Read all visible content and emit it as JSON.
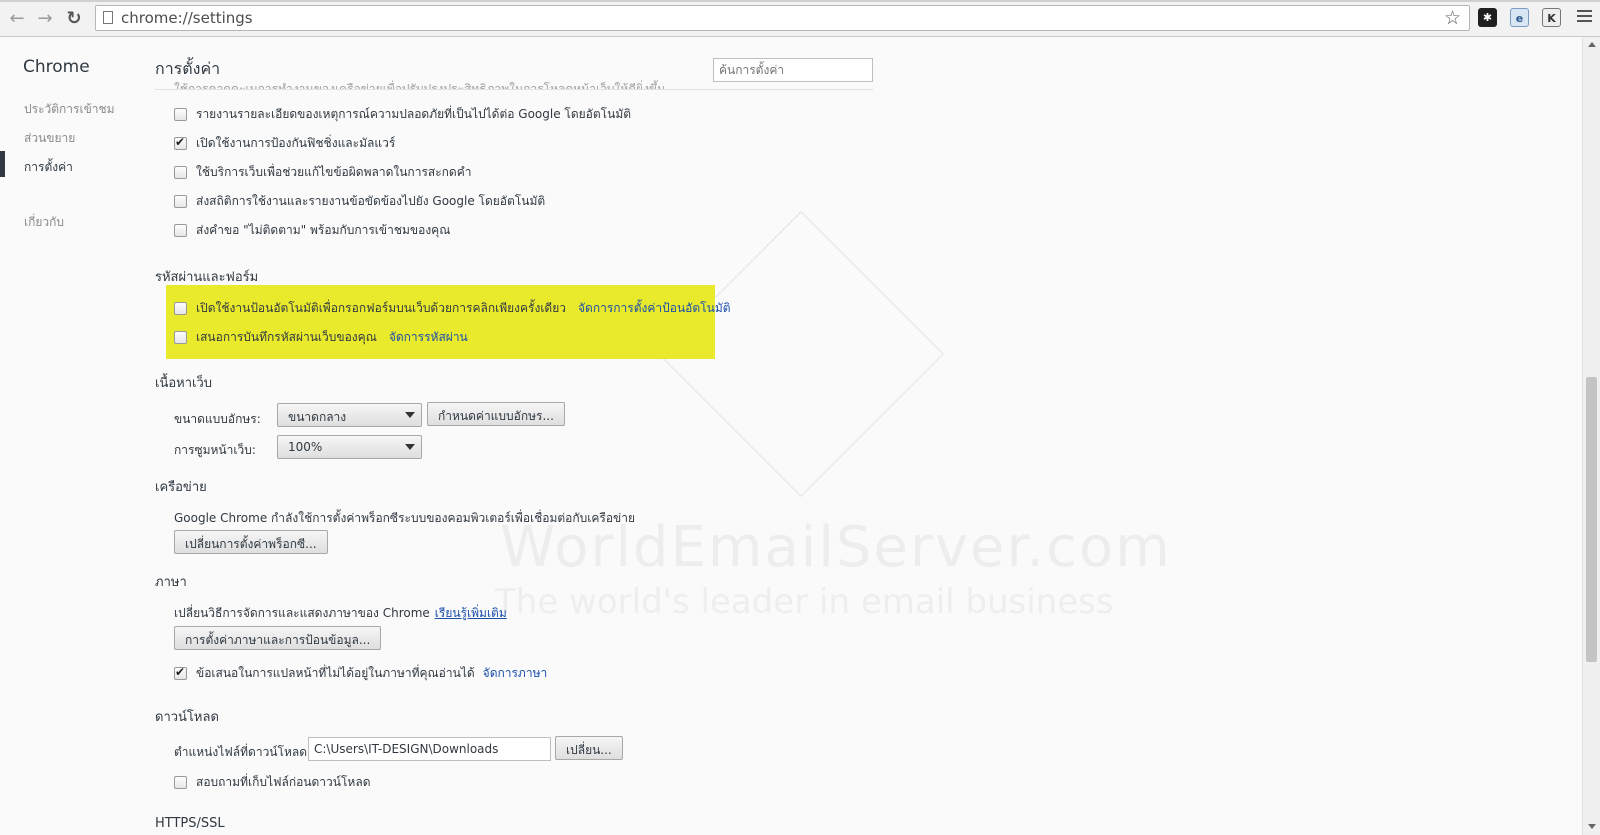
{
  "browser": {
    "url": "chrome://settings",
    "back_icon": "back-arrow-icon",
    "forward_icon": "forward-arrow-icon",
    "reload_icon": "reload-icon"
  },
  "sidebar": {
    "title": "Chrome",
    "items": [
      {
        "label": "ประวัติการเข้าชม"
      },
      {
        "label": "ส่วนขยาย"
      },
      {
        "label": "การตั้งค่า",
        "active": true
      },
      {
        "label": "เกี่ยวกับ"
      }
    ]
  },
  "header": {
    "title": "การตั้งค่า",
    "search_placeholder": "ค้นการตั้งค่า"
  },
  "privacy": {
    "clipped_row": "ใช้การคาดคะเนการทำงานของเครือข่ายเพื่อปรับปรุงประสิทธิภาพในการโหลดหน้าเว็บให้ดียิ่งขึ้น",
    "options": [
      {
        "label": "รายงานรายละเอียดของเหตุการณ์ความปลอดภัยที่เป็นไปได้ต่อ Google โดยอัตโนมัติ",
        "checked": false
      },
      {
        "label": "เปิดใช้งานการป้องกันฟิชชิ่งและมัลแวร์",
        "checked": true
      },
      {
        "label": "ใช้บริการเว็บเพื่อช่วยแก้ไขข้อผิดพลาดในการสะกดคำ",
        "checked": false
      },
      {
        "label": "ส่งสถิติการใช้งานและรายงานข้อขัดข้องไปยัง Google โดยอัตโนมัติ",
        "checked": false
      },
      {
        "label": "ส่งคำขอ \"ไม่ติดตาม\" พร้อมกับการเข้าชมของคุณ",
        "checked": false
      }
    ]
  },
  "passwords": {
    "title": "รหัสผ่านและฟอร์ม",
    "highlight_color": "#eaea2c",
    "autofill_label": "เปิดใช้งานป้อนอัตโนมัติเพื่อกรอกฟอร์มบนเว็บด้วยการคลิกเพียงครั้งเดียว",
    "autofill_link": "จัดการการตั้งค่าป้อนอัตโนมัติ",
    "save_pw_label": "เสนอการบันทึกรหัสผ่านเว็บของคุณ",
    "save_pw_link": "จัดการรหัสผ่าน"
  },
  "web_content": {
    "title": "เนื้อหาเว็บ",
    "font_size_label": "ขนาดแบบอักษร:",
    "font_size_value": "ขนาดกลาง",
    "customize_fonts_button": "กำหนดค่าแบบอักษร...",
    "zoom_label": "การซูมหน้าเว็บ:",
    "zoom_value": "100%"
  },
  "network": {
    "title": "เครือข่าย",
    "description": "Google Chrome กำลังใช้การตั้งค่าพร็อกซีระบบของคอมพิวเตอร์เพื่อเชื่อมต่อกับเครือข่าย",
    "proxy_button": "เปลี่ยนการตั้งค่าพร็อกซี..."
  },
  "languages": {
    "title": "ภาษา",
    "description": "เปลี่ยนวิธีการจัดการและแสดงภาษาของ Chrome",
    "learn_more": "เรียนรู้เพิ่มเติม",
    "settings_button": "การตั้งค่าภาษาและการป้อนข้อมูล...",
    "translate_label": "ข้อเสนอในการแปลหน้าที่ไม่ได้อยู่ในภาษาที่คุณอ่านได้",
    "translate_checked": true,
    "manage_link": "จัดการภาษา"
  },
  "downloads": {
    "title": "ดาวน์โหลด",
    "location_label": "ตำแหน่งไฟล์ที่ดาวน์โหลด:",
    "location_value": "C:\\Users\\IT-DESIGN\\Downloads",
    "change_button": "เปลี่ยน...",
    "ask_label": "สอบถามที่เก็บไฟล์ก่อนดาวน์โหลด",
    "ask_checked": false
  },
  "https": {
    "title": "HTTPS/SSL"
  },
  "watermark": {
    "line1": "WorldEmailServer.com",
    "line2": "The world's leader in email business"
  }
}
